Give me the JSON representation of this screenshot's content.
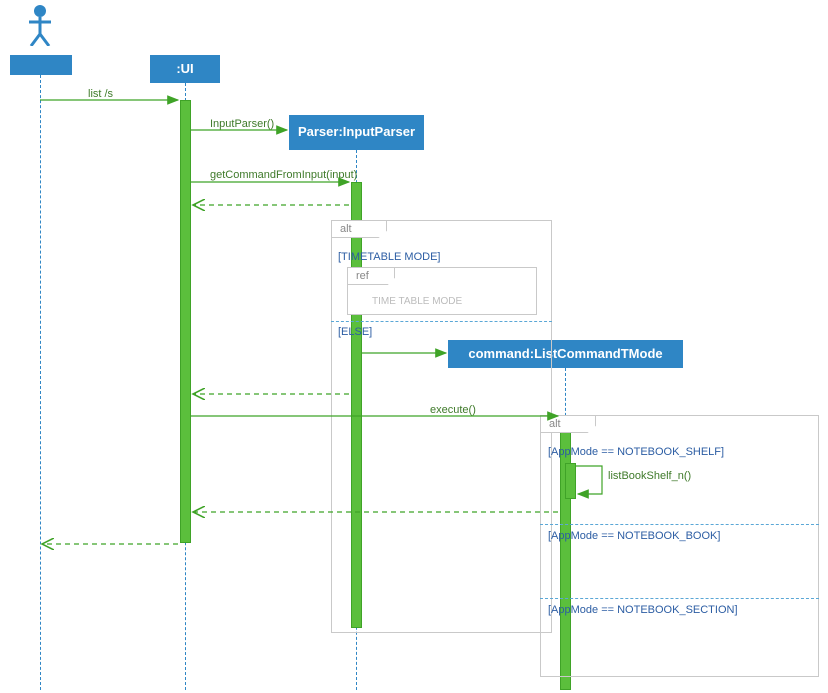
{
  "actor": {
    "label": ""
  },
  "ui": {
    "label": ":UI"
  },
  "parser": {
    "label": "Parser:InputParser"
  },
  "command": {
    "label": "command:ListCommandTMode"
  },
  "messages": {
    "list": "list /s",
    "inputParser": "InputParser()",
    "getCommand": "getCommandFromInput(input)",
    "execute": "execute()",
    "listBookShelf": "listBookShelf_n()"
  },
  "fragments": {
    "alt1": {
      "tag": "alt"
    },
    "ref": {
      "tag": "ref",
      "text": "TIME TABLE MODE"
    },
    "alt2": {
      "tag": "alt"
    }
  },
  "guards": {
    "timetable": "[TIMETABLE MODE]",
    "else": "[ELSE]",
    "shelf": "[AppMode == NOTEBOOK_SHELF]",
    "book": "[AppMode == NOTEBOOK_BOOK]",
    "section": "[AppMode == NOTEBOOK_SECTION]"
  },
  "colors": {
    "blue": "#2f86c5",
    "green": "#5bbf3c",
    "darkgreen": "#3f7a2a",
    "guardblue": "#2c5da3"
  }
}
